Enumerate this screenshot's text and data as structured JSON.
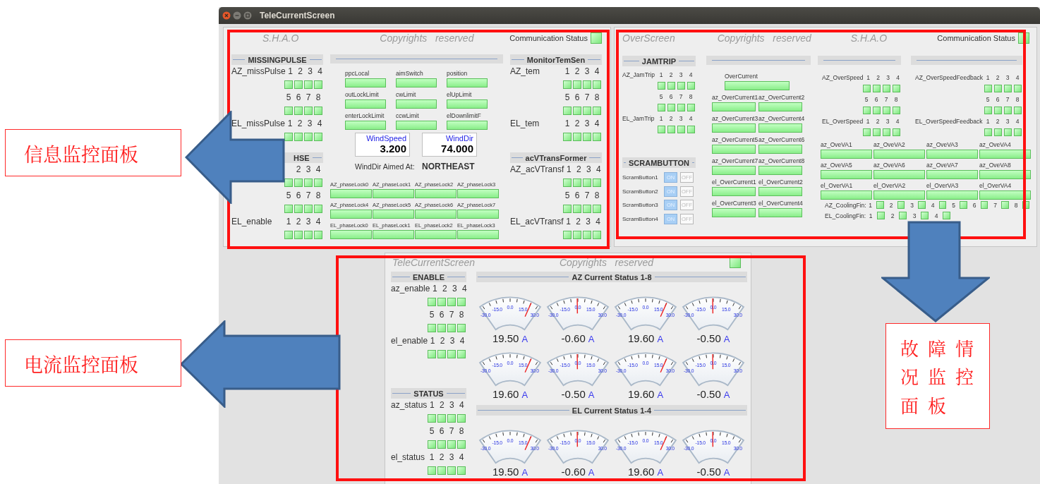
{
  "window": {
    "title": "TeleCurrentScreen"
  },
  "info_panel": {
    "header": {
      "left": "S.H.A.O",
      "center": "Copyrights   reserved",
      "status_label": "Communication Status"
    },
    "left_sections": [
      {
        "title": "MISSINGPULSE",
        "rows": [
          {
            "label": "AZ_missPulse",
            "nums": [
              "1",
              "2",
              "3",
              "4"
            ]
          },
          {
            "nums": [
              "5",
              "6",
              "7",
              "8"
            ]
          },
          {
            "label": "EL_missPulse",
            "nums": [
              "1",
              "2",
              "3",
              "4"
            ]
          }
        ]
      },
      {
        "title": "HSE",
        "rows": [
          {
            "nums": [
              "2",
              "3",
              "4"
            ]
          },
          {
            "nums": [
              "5",
              "6",
              "7",
              "8"
            ]
          },
          {
            "label": "EL_enable",
            "nums": [
              "1",
              "2",
              "3",
              "4"
            ]
          }
        ]
      }
    ],
    "switches": [
      "ppcLocal",
      "aimSwitch",
      "position",
      "outLockLimit",
      "cwLimit",
      "elUpLimit",
      "enterLockLimit",
      "ccwLimit",
      "elDownlimitF"
    ],
    "wind": [
      {
        "label": "WindSpeed",
        "value": "3.200"
      },
      {
        "label": "WindDir",
        "value": "74.000"
      }
    ],
    "aim": {
      "label": "WindDir Aimed At:",
      "value": "NORTHEAST"
    },
    "phase_locks": [
      "AZ_phaseLock0",
      "AZ_phaseLock1",
      "AZ_phaseLock2",
      "AZ_phaseLock3",
      "AZ_phaseLock4",
      "AZ_phaseLock5",
      "AZ_phaseLock6",
      "AZ_phaseLock7",
      "EL_phaseLock0",
      "EL_phaseLock1",
      "EL_phaseLock2",
      "EL_phaseLock3"
    ],
    "right_sections": [
      {
        "title": "MonitorTemSen",
        "rows": [
          {
            "label": "AZ_tem",
            "nums": [
              "1",
              "2",
              "3",
              "4"
            ]
          },
          {
            "nums": [
              "5",
              "6",
              "7",
              "8"
            ]
          },
          {
            "label": "EL_tem",
            "nums": [
              "1",
              "2",
              "3",
              "4"
            ]
          }
        ]
      },
      {
        "title": "acVTransFormer",
        "rows": [
          {
            "label": "AZ_acVTransf",
            "nums": [
              "1",
              "2",
              "3",
              "4"
            ]
          },
          {
            "nums": [
              "5",
              "6",
              "7",
              "8"
            ]
          },
          {
            "label": "EL_acVTransf",
            "nums": [
              "1",
              "2",
              "3",
              "4"
            ]
          }
        ]
      }
    ]
  },
  "fault_panel": {
    "header": {
      "items": [
        "OverScreen",
        "Copyrights   reserved",
        "S.H.A.O"
      ],
      "status_label": "Communication Status"
    },
    "jamtrip": {
      "title": "JAMTRIP",
      "rows": [
        {
          "label": "AZ_JamTrip",
          "nums": [
            "1",
            "2",
            "3",
            "4"
          ]
        },
        {
          "nums": [
            "5",
            "6",
            "7",
            "8"
          ]
        },
        {
          "label": "EL_JamTrip",
          "nums": [
            "1",
            "2",
            "3",
            "4"
          ]
        }
      ]
    },
    "scram": {
      "title": "SCRAMBUTTON",
      "buttons": [
        {
          "label": "ScramButton1",
          "on_label": "ON",
          "off_label": "OFF",
          "on": true
        },
        {
          "label": "ScramButton2",
          "on_label": "ON",
          "off_label": "OFF",
          "on": true
        },
        {
          "label": "ScramButton3",
          "on_label": "ON",
          "off_label": "OFF",
          "on": true
        },
        {
          "label": "ScramButton4",
          "on_label": "ON",
          "off_label": "OFF",
          "on": true
        }
      ]
    },
    "overcurrent": {
      "main": "OverCurrent",
      "items": [
        "az_OverCurrent1",
        "az_OverCurrent2",
        "az_OverCurrent3",
        "az_OverCurrent4",
        "az_OverCurrent5",
        "az_OverCurrent6",
        "az_OverCurrent7",
        "az_OverCurrent8",
        "el_OverCurrent1",
        "el_OverCurrent2",
        "el_OverCurrent3",
        "el_OverCurrent4"
      ]
    },
    "overspeed": [
      {
        "rows": [
          {
            "label": "AZ_OverSpeed",
            "nums": [
              "1",
              "2",
              "3",
              "4"
            ]
          },
          {
            "nums": [
              "5",
              "6",
              "7",
              "8"
            ]
          },
          {
            "label": "EL_OverSpeed",
            "nums": [
              "1",
              "2",
              "3",
              "4"
            ]
          }
        ]
      },
      {
        "rows": [
          {
            "label": "AZ_OverSpeedFeedback",
            "nums": [
              "1",
              "2",
              "3",
              "4"
            ]
          },
          {
            "nums": [
              "5",
              "6",
              "7",
              "8"
            ]
          },
          {
            "label": "EL_OverSpeedFeedback",
            "nums": [
              "1",
              "2",
              "3",
              "4"
            ]
          }
        ]
      }
    ],
    "va": [
      "az_OveVA1",
      "az_OveVA2",
      "az_OveVA3",
      "az_OveVA4",
      "az_OveVA5",
      "az_OveVA6",
      "az_OveVA7",
      "az_OveVA8",
      "el_OverVA1",
      "el_OverVA2",
      "el_OverVA3",
      "el_OverVA4"
    ],
    "cooling": [
      {
        "label": "AZ_CoolingFin:",
        "nums": [
          "1",
          "2",
          "3",
          "4",
          "5",
          "6",
          "7",
          "8"
        ]
      },
      {
        "label": "EL_CoolingFin:",
        "nums": [
          "1",
          "2",
          "3",
          "4"
        ]
      }
    ]
  },
  "current_panel": {
    "header": {
      "left": "TeleCurrentScreen",
      "center": "Copyrights   reserved"
    },
    "sections": [
      {
        "title": "ENABLE",
        "rows": [
          {
            "label": "az_enable",
            "nums": [
              "1",
              "2",
              "3",
              "4"
            ]
          },
          {
            "nums": [
              "5",
              "6",
              "7",
              "8"
            ]
          },
          {
            "label": "el_enable",
            "nums": [
              "1",
              "2",
              "3",
              "4"
            ]
          }
        ]
      },
      {
        "title": "STATUS",
        "rows": [
          {
            "label": "az_status",
            "nums": [
              "1",
              "2",
              "3",
              "4"
            ]
          },
          {
            "nums": [
              "5",
              "6",
              "7",
              "8"
            ]
          },
          {
            "label": "el_status",
            "nums": [
              "1",
              "2",
              "3",
              "4"
            ]
          }
        ]
      }
    ],
    "gauge_groups": [
      {
        "title": "AZ Current Status 1-8",
        "gauges": [
          {
            "value": "19.50",
            "unit": "A",
            "level": 0.83,
            "ticks": [
              "-30.0",
              "-15.0",
              "0.0",
              "15.0",
              "30.0"
            ]
          },
          {
            "value": "-0.60",
            "unit": "A",
            "level": 0.49,
            "ticks": [
              "-30.0",
              "-15.0",
              "0.0",
              "15.0",
              "30.0"
            ]
          },
          {
            "value": "19.60",
            "unit": "A",
            "level": 0.83,
            "ticks": [
              "-30.0",
              "-15.0",
              "0.0",
              "15.0",
              "30.0"
            ]
          },
          {
            "value": "-0.50",
            "unit": "A",
            "level": 0.49,
            "ticks": [
              "-30.0",
              "-15.0",
              "0.0",
              "15.0",
              "30.0"
            ]
          },
          {
            "value": "19.60",
            "unit": "A",
            "level": 0.83,
            "ticks": [
              "-30.0",
              "-15.0",
              "0.0",
              "15.0",
              "30.0"
            ]
          },
          {
            "value": "-0.50",
            "unit": "A",
            "level": 0.49,
            "ticks": [
              "-30.0",
              "-15.0",
              "0.0",
              "15.0",
              "30.0"
            ]
          },
          {
            "value": "19.60",
            "unit": "A",
            "level": 0.83,
            "ticks": [
              "-30.0",
              "-15.0",
              "0.0",
              "15.0",
              "30.0"
            ]
          },
          {
            "value": "-0.50",
            "unit": "A",
            "level": 0.49,
            "ticks": [
              "-30.0",
              "-15.0",
              "0.0",
              "15.0",
              "30.0"
            ]
          }
        ]
      },
      {
        "title": "EL Current Status 1-4",
        "gauges": [
          {
            "value": "19.50",
            "unit": "A",
            "level": 0.83,
            "ticks": [
              "-30.0",
              "-15.0",
              "0.0",
              "15.0",
              "30.0"
            ]
          },
          {
            "value": "-0.60",
            "unit": "A",
            "level": 0.49,
            "ticks": [
              "-30.0",
              "-15.0",
              "0.0",
              "15.0",
              "30.0"
            ]
          },
          {
            "value": "19.60",
            "unit": "A",
            "level": 0.83,
            "ticks": [
              "-30.0",
              "-15.0",
              "0.0",
              "15.0",
              "30.0"
            ]
          },
          {
            "value": "-0.50",
            "unit": "A",
            "level": 0.49,
            "ticks": [
              "-30.0",
              "-15.0",
              "0.0",
              "15.0",
              "30.0"
            ]
          }
        ]
      }
    ]
  },
  "annotations": [
    {
      "text": "信息监控面板"
    },
    {
      "text": "电流监控面板"
    },
    {
      "text": "故障情况监控面板"
    }
  ]
}
